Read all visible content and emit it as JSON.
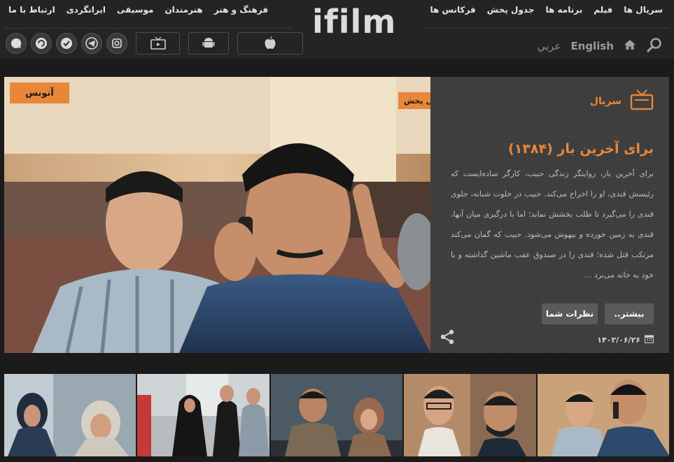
{
  "header": {
    "logo": "ifilm",
    "nav_right": [
      "سریال ها",
      "فیلم",
      "برنامه ها",
      "جدول پخش",
      "فرکانس ها"
    ],
    "nav_left": [
      "فرهنگ و هنر",
      "هنرمندان",
      "موسیقی",
      "ایرانگردی",
      "ارتباط با ما"
    ],
    "lang_english": "English",
    "lang_arabic": "عربي",
    "social_icons": [
      "ifilm-chat-icon",
      "eitaa-icon",
      "check-app-icon",
      "telegram-icon",
      "instagram-icon"
    ],
    "app_icons": [
      "tv-app-icon",
      "android-icon",
      "apple-icon"
    ]
  },
  "hero": {
    "badge_announce": "آنونس",
    "badge_live": "درحال پخش",
    "category": "سریال",
    "title": "برای آخرین بار (۱۳۸۴)",
    "description": "برای آخرین بار، روایتگر زندگی حبیب، کارگر ساده‌ایست که رئیسش قندی، او را اخراج می‌کند. حبیب در خلوت شبانه، جلوی قندی را می‌گیرد تا طلب بخشش نماید؛ اما با درگیری میان آنها، قندی به زمین خورده و بیهوش می‌شود. حبیب که گمان می‌کند مرتکب قتل شده؛ قندی را در صندوق عقب ماشین گذاشته و با خود به خانه می‌برد ...",
    "btn_more": "بیشتر..",
    "btn_comments": "نظرات شما",
    "date": "۱۴۰۲/۰۶/۲۶"
  },
  "colors": {
    "accent": "#e8873a",
    "background": "#1b1b1b",
    "header": "#242424",
    "panel": "#3d3d3d"
  }
}
